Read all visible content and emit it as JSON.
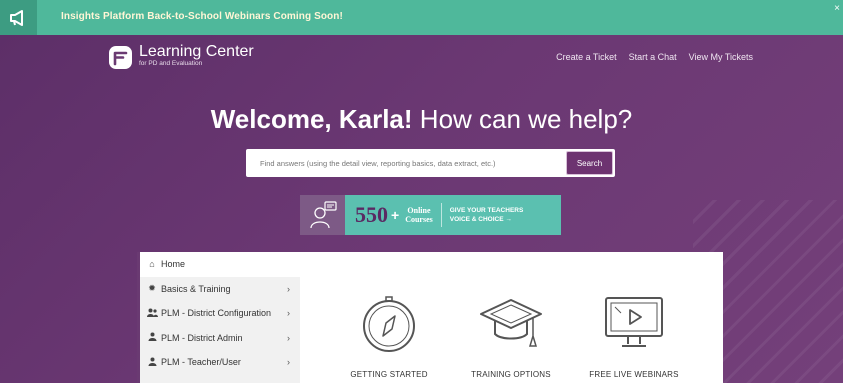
{
  "announcement": {
    "message": "Insights Platform Back-to-School Webinars Coming Soon!",
    "close_label": "×",
    "icon": "megaphone-icon"
  },
  "header": {
    "logo_title": "Learning Center",
    "logo_subtitle": "for PD and Evaluation",
    "nav": [
      {
        "label": "Create a Ticket"
      },
      {
        "label": "Start a Chat"
      },
      {
        "label": "View My Tickets"
      }
    ]
  },
  "hero": {
    "welcome_bold": "Welcome, Karla!",
    "welcome_light": "How can we help?",
    "search_placeholder": "Find answers (using the detail view, reporting basics, data extract, etc.)",
    "search_button": "Search"
  },
  "promo": {
    "count": "550",
    "plus": "+",
    "line1": "Online",
    "line2": "Courses",
    "cta1": "GIVE YOUR TEACHERS",
    "cta2": "VOICE & CHOICE →"
  },
  "sidebar": {
    "items": [
      {
        "label": "Home",
        "icon": "home-icon"
      },
      {
        "label": "Basics & Training",
        "icon": "gear-icon"
      },
      {
        "label": "PLM - District Configuration",
        "icon": "users-icon"
      },
      {
        "label": "PLM - District Admin",
        "icon": "user-icon"
      },
      {
        "label": "PLM - Teacher/User",
        "icon": "user-icon"
      }
    ],
    "chevron": "›"
  },
  "tiles": [
    {
      "label": "GETTING STARTED",
      "icon": "compass-icon"
    },
    {
      "label": "TRAINING OPTIONS",
      "icon": "graduation-cap-icon"
    },
    {
      "label": "FREE LIVE WEBINARS",
      "icon": "monitor-play-icon"
    }
  ],
  "colors": {
    "announce_bg": "#4fb89b",
    "hero_bg": "#6a3a72",
    "promo_bg": "#5bc0b0",
    "search_button_bg": "#6d3370"
  }
}
